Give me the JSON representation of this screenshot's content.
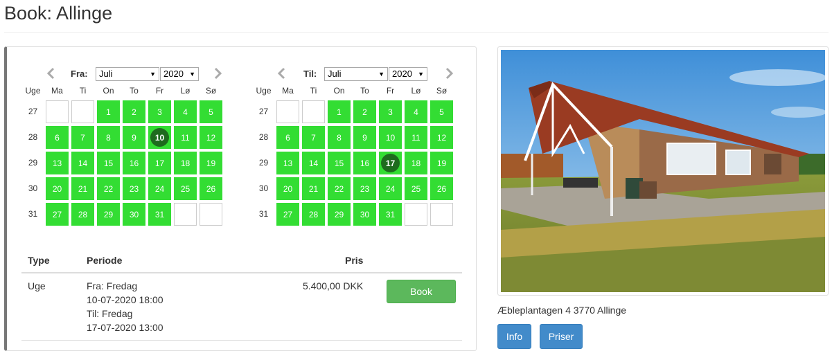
{
  "page": {
    "title": "Book: Allinge"
  },
  "colors": {
    "available": "#33dd33",
    "selected": "#1e6b1e",
    "book_button": "#5cb85c",
    "nav_button": "#428bca"
  },
  "icons": {
    "prev": "chevron-left-icon",
    "next": "chevron-right-icon"
  },
  "week_header": "Uge",
  "weekdays": [
    "Ma",
    "Ti",
    "On",
    "To",
    "Fr",
    "Lø",
    "Sø"
  ],
  "weeks": [
    {
      "week": "27",
      "days": [
        "",
        "",
        "1",
        "2",
        "3",
        "4",
        "5"
      ]
    },
    {
      "week": "28",
      "days": [
        "6",
        "7",
        "8",
        "9",
        "10",
        "11",
        "12"
      ]
    },
    {
      "week": "29",
      "days": [
        "13",
        "14",
        "15",
        "16",
        "17",
        "18",
        "19"
      ]
    },
    {
      "week": "30",
      "days": [
        "20",
        "21",
        "22",
        "23",
        "24",
        "25",
        "26"
      ]
    },
    {
      "week": "31",
      "days": [
        "27",
        "28",
        "29",
        "30",
        "31",
        "",
        ""
      ]
    }
  ],
  "from_calendar": {
    "label": "Fra:",
    "month": "Juli",
    "year": "2020",
    "selected_day": "10"
  },
  "to_calendar": {
    "label": "Til:",
    "month": "Juli",
    "year": "2020",
    "selected_day": "17"
  },
  "table": {
    "headers": {
      "type": "Type",
      "period": "Periode",
      "price": "Pris"
    },
    "row": {
      "type": "Uge",
      "period_lines": [
        "Fra: Fredag",
        "10-07-2020 18:00",
        "Til: Fredag",
        "17-07-2020 13:00"
      ],
      "price": "5.400,00 DKK",
      "book_label": "Book"
    }
  },
  "property": {
    "address": "Æbleplantagen 4 3770 Allinge",
    "info_label": "Info",
    "prices_label": "Priser"
  }
}
